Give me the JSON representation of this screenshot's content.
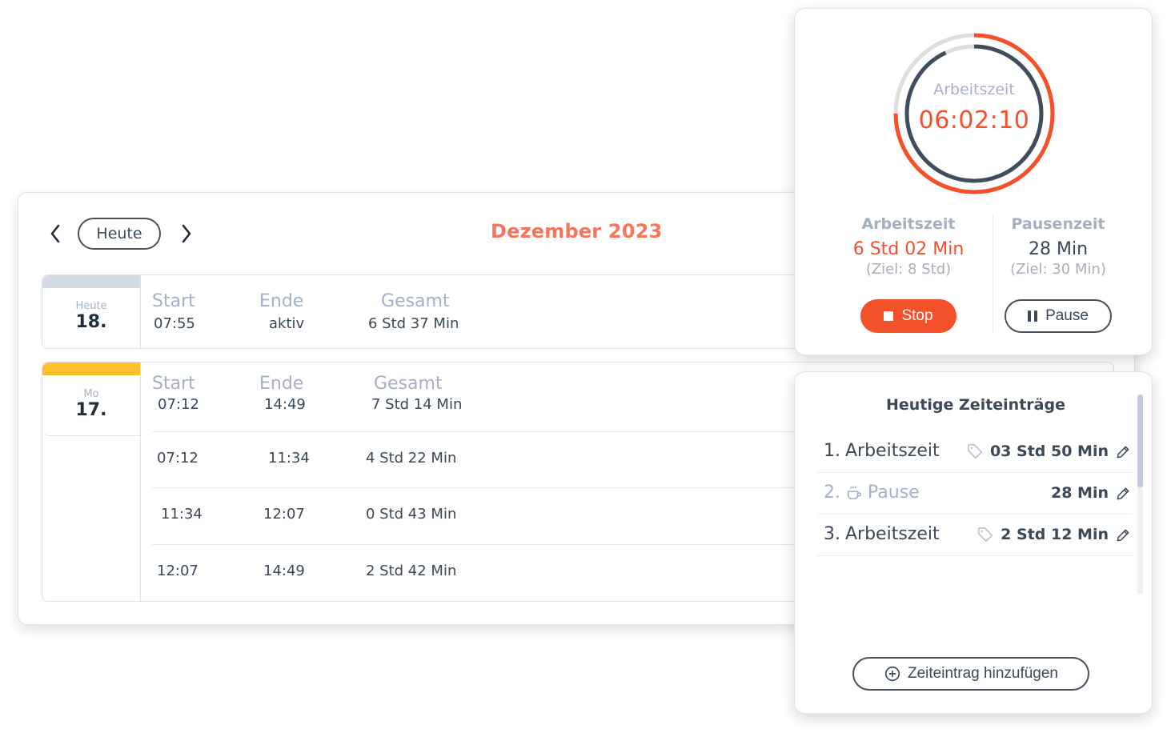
{
  "calendar": {
    "prev_icon": "chevron-left-icon",
    "next_icon": "chevron-right-icon",
    "today_label": "Heute",
    "month_title": "Dezember 2023",
    "days": [
      {
        "label": "Heute",
        "number": "18.",
        "bar_color": "#d6dce6",
        "headers": {
          "start": "Start",
          "end": "Ende",
          "total": "Gesamt"
        },
        "summary": {
          "start": "07:55",
          "end": "aktiv",
          "total": "6 Std 37 Min"
        },
        "rows": []
      },
      {
        "label": "Mo",
        "number": "17.",
        "bar_color": "#fbc02d",
        "headers": {
          "start": "Start",
          "end": "Ende",
          "total": "Gesamt"
        },
        "summary": {
          "start": "07:12",
          "end": "14:49",
          "total": "7 Std 14 Min"
        },
        "rows": [
          {
            "start": "07:12",
            "end": "11:34",
            "total": "4 Std 22 Min"
          },
          {
            "start": "11:34",
            "end": "12:07",
            "total": "0 Std 43 Min"
          },
          {
            "start": "12:07",
            "end": "14:49",
            "total": "2 Std 42 Min"
          }
        ]
      }
    ]
  },
  "timer": {
    "ring_label": "Arbeitszeit",
    "elapsed": "06:02:10",
    "outer_progress": 0.75,
    "inner_progress": 0.93,
    "colors": {
      "accent": "#f4502a",
      "dark": "#3f4d5c",
      "track": "#dedede"
    },
    "work": {
      "title": "Arbeitszeit",
      "value": "6 Std 02 Min",
      "goal": "(Ziel: 8 Std)"
    },
    "break": {
      "title": "Pausenzeit",
      "value": "28 Min",
      "goal": "(Ziel: 30 Min)"
    },
    "stop_label": "Stop",
    "pause_label": "Pause"
  },
  "entries": {
    "title": "Heutige Zeiteinträge",
    "items": [
      {
        "index": "1.",
        "name": "Arbeitszeit",
        "type": "work",
        "icon": "tag-icon",
        "duration": "03 Std 50 Min"
      },
      {
        "index": "2.",
        "name": "Pause",
        "type": "pause",
        "icon": "coffee-icon",
        "duration": "28 Min"
      },
      {
        "index": "3.",
        "name": "Arbeitszeit",
        "type": "work",
        "icon": "tag-icon",
        "duration": "2 Std 12 Min"
      }
    ],
    "add_label": "Zeiteintrag hinzufügen"
  }
}
